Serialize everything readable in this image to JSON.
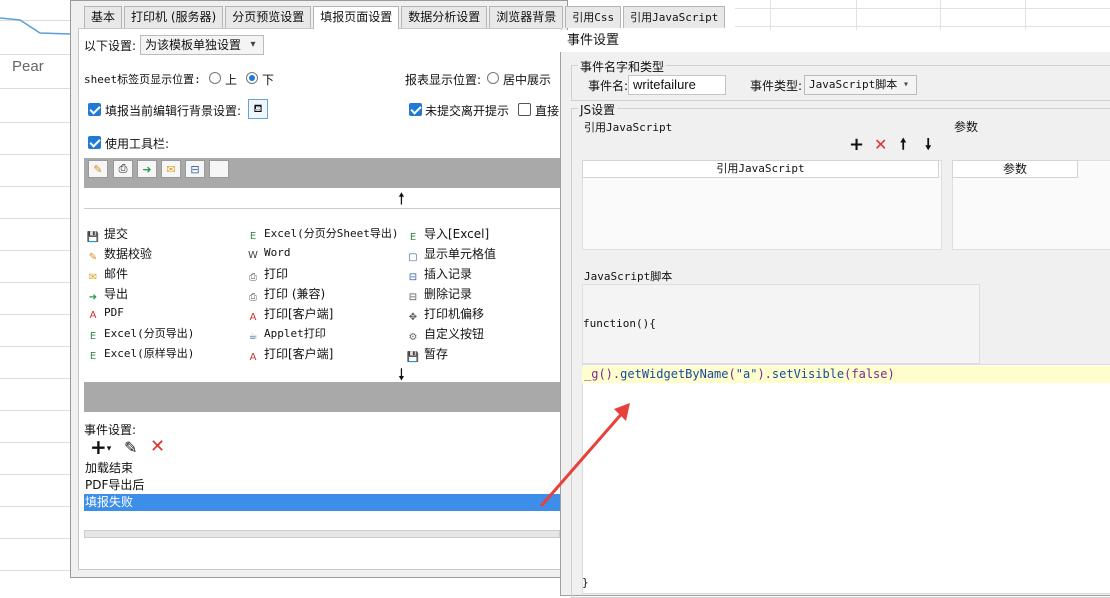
{
  "background": {
    "label": "Pear"
  },
  "tabs": [
    "基本",
    "打印机 (服务器)",
    "分页预览设置",
    "填报页面设置",
    "数据分析设置",
    "浏览器背景",
    "引用Css",
    "引用JavaScript"
  ],
  "active_tab_index": 3,
  "settings": {
    "scope_label": "以下设置:",
    "scope_value": "为该模板单独设置",
    "sheet_tab_pos_label": "sheet标签页显示位置:",
    "sheet_tab_top": "上",
    "sheet_tab_bottom": "下",
    "sheet_tab_selected": "下",
    "report_pos_label": "报表显示位置:",
    "report_pos_center": "居中展示",
    "highlight_label": "填报当前编辑行背景设置:",
    "unsubmitted_label": "未提交离开提示",
    "direct_label": "直接",
    "use_toolbar_label": "使用工具栏:"
  },
  "toolbar_icons": [
    "pencil-icon",
    "printer-icon",
    "export-icon",
    "mail-icon",
    "insert-row-icon",
    "blank-cell-icon"
  ],
  "buttons": [
    [
      "提交",
      "Excel(分页分Sheet导出)",
      "导入[Excel]"
    ],
    [
      "数据校验",
      "Word",
      "显示单元格值"
    ],
    [
      "邮件",
      "打印",
      "插入记录"
    ],
    [
      "导出",
      "打印 (兼容)",
      "删除记录"
    ],
    [
      "PDF",
      "打印[客户端]",
      "打印机偏移"
    ],
    [
      "Excel(分页导出)",
      "Applet打印",
      "自定义按钮"
    ],
    [
      "Excel(原样导出)",
      "打印[客户端]",
      "暂存"
    ]
  ],
  "events": {
    "label": "事件设置:",
    "items": [
      "加载结束",
      "PDF导出后",
      "填报失败"
    ],
    "selected_index": 2
  },
  "event_dialog": {
    "title": "事件设置",
    "group_name_type": "事件名字和类型",
    "name_label": "事件名:",
    "name_value": "writefailure",
    "type_label": "事件类型:",
    "type_value": "JavaScript脚本",
    "js_group": "JS设置",
    "ref_js_label": "引用JavaScript",
    "params_label": "参数",
    "ref_js_header": "引用JavaScript",
    "params_header": "参数",
    "script_label": "JavaScript脚本",
    "func_open": "function(){",
    "code_parts": {
      "a": "_g",
      "b": "().",
      "c": "getWidgetByName",
      "d": "(",
      "e": "\"a\"",
      "f": ").",
      "g": "setVisible",
      "h": "(",
      "i": "false",
      "j": ")"
    },
    "func_close": "}"
  },
  "colors": {
    "selection": "#3c8ee8",
    "code_bg": "#fefecc",
    "arrow": "#e8413c",
    "checkbox": "#1e7ad8"
  }
}
